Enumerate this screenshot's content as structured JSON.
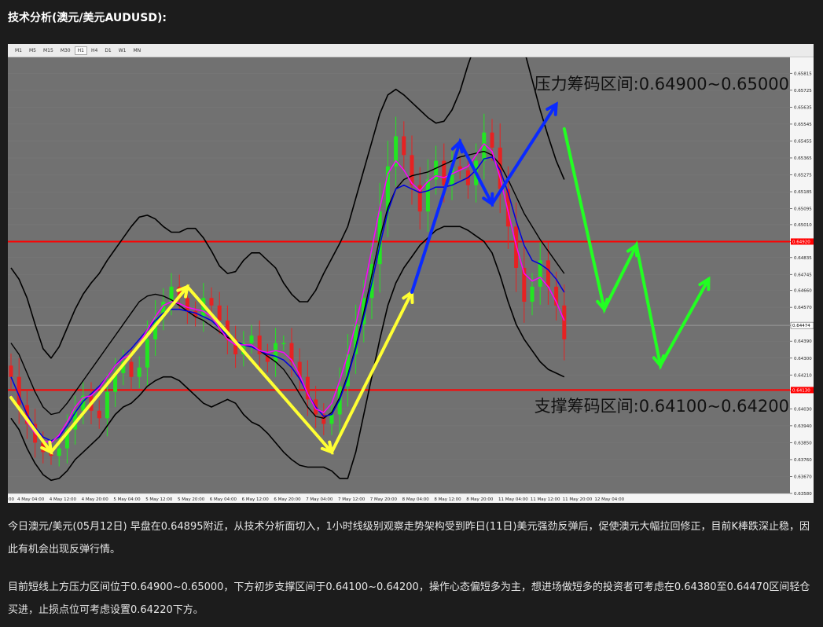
{
  "page": {
    "title": "技术分析(澳元/美元AUDUSD):",
    "paragraphs": [
      "今日澳元/美元(05月12日) 早盘在0.64895附近，从技术分析面切入，1小时线级别观察走势架构受到昨日(11日)美元强劲反弹后，促使澳元大幅拉回修正，目前K棒跌深止稳，因此有机会出现反弹行情。",
      "目前短线上方压力区间位于0.64900~0.65000，下方初步支撑区间于0.64100~0.64200，操作心态偏短多为主，想进场做短多的投资者可考虑在0.64380至0.64470区间轻仓买进，止损点位可考虑设置0.64220下方。"
    ]
  },
  "toolbar": {
    "timeframes": [
      "M1",
      "M5",
      "M15",
      "M30",
      "H1",
      "H4",
      "D1",
      "W1",
      "MN"
    ],
    "active": "H1"
  },
  "colors": {
    "page_bg": "#1c1c1c",
    "plot_bg": "#717171",
    "up_candle": "#22e622",
    "down_candle": "#e62222",
    "level_line": "#ff0000",
    "band_line": "#000000",
    "ma_fast": "#ff00ff",
    "ma_slow": "#0000dd",
    "yellow_arrow": "#ffff33",
    "blue_arrow": "#0a2aff",
    "green_arrow": "#22ff22"
  },
  "chart_data": {
    "type": "candlestick",
    "instrument": "AUDUSD",
    "timeframe": "H1",
    "ylim": [
      0.6358,
      0.659
    ],
    "y_ticks": [
      "0.65815",
      "0.65725",
      "0.65635",
      "0.65545",
      "0.65455",
      "0.65365",
      "0.65275",
      "0.65185",
      "0.65095",
      "0.65010",
      "0.64920",
      "0.64835",
      "0.64745",
      "0.64660",
      "0.64570",
      "0.64474",
      "0.64390",
      "0.64300",
      "0.64210",
      "0.64125",
      "0.64030",
      "0.63940",
      "0.63850",
      "0.63760",
      "0.63670",
      "0.63580"
    ],
    "x_ticks": [
      "00",
      "4 May 04:00",
      "4 May 12:00",
      "4 May 20:00",
      "5 May 04:00",
      "5 May 12:00",
      "5 May 20:00",
      "6 May 04:00",
      "6 May 12:00",
      "6 May 20:00",
      "7 May 04:00",
      "7 May 12:00",
      "7 May 20:00",
      "8 May 04:00",
      "8 May 12:00",
      "8 May 20:00",
      "11 May 04:00",
      "11 May 12:00",
      "11 May 20:00",
      "12 May 04:00"
    ],
    "horizontal_levels": [
      {
        "value": 0.6492,
        "label": "0.64920"
      },
      {
        "value": 0.6413,
        "label": "0.64130"
      }
    ],
    "current_price": {
      "value": 0.64474,
      "label": "0.64474"
    },
    "annotations": [
      "压力筹码区间:0.64900~0.65000",
      "支撑筹码区间:0.64100~0.64200"
    ],
    "close_series": [
      0.642,
      0.6405,
      0.6395,
      0.6385,
      0.638,
      0.6378,
      0.6382,
      0.6392,
      0.6402,
      0.641,
      0.6402,
      0.6398,
      0.6412,
      0.6422,
      0.6428,
      0.642,
      0.6425,
      0.644,
      0.6452,
      0.646,
      0.6468,
      0.6462,
      0.6455,
      0.6452,
      0.6462,
      0.6458,
      0.645,
      0.644,
      0.6432,
      0.6438,
      0.6442,
      0.6432,
      0.6428,
      0.6438,
      0.6438,
      0.6428,
      0.642,
      0.6408,
      0.64,
      0.6395,
      0.64,
      0.6415,
      0.6432,
      0.6448,
      0.6462,
      0.648,
      0.6508,
      0.6532,
      0.6548,
      0.6538,
      0.6522,
      0.6508,
      0.6525,
      0.6535,
      0.6522,
      0.6532,
      0.653,
      0.6522,
      0.6535,
      0.655,
      0.6542,
      0.652,
      0.65,
      0.6478,
      0.646,
      0.6468,
      0.6482,
      0.6468,
      0.6458,
      0.644
    ],
    "moving_average_fast": [
      0.641,
      0.6403,
      0.6396,
      0.639,
      0.6386,
      0.6385,
      0.6389,
      0.6396,
      0.6404,
      0.6409,
      0.641,
      0.6414,
      0.642,
      0.6426,
      0.643,
      0.6432,
      0.6438,
      0.6445,
      0.6452,
      0.6458,
      0.646,
      0.6459,
      0.6457,
      0.6456,
      0.6455,
      0.6452,
      0.6446,
      0.644,
      0.6437,
      0.6437,
      0.6437,
      0.6434,
      0.6433,
      0.6434,
      0.6433,
      0.6429,
      0.6421,
      0.6411,
      0.6403,
      0.6401,
      0.6406,
      0.6418,
      0.6432,
      0.6448,
      0.6466,
      0.6488,
      0.651,
      0.6528,
      0.6535,
      0.653,
      0.6523,
      0.6519,
      0.6524,
      0.6527,
      0.6526,
      0.6528,
      0.653,
      0.6532,
      0.6538,
      0.6544,
      0.654,
      0.6526,
      0.6508,
      0.649,
      0.6475,
      0.6471,
      0.6473,
      0.6468,
      0.646,
      0.645
    ],
    "moving_average_slow": [
      0.642,
      0.641,
      0.64,
      0.6393,
      0.6388,
      0.6386,
      0.6388,
      0.6394,
      0.6401,
      0.6407,
      0.6411,
      0.6415,
      0.642,
      0.6426,
      0.6431,
      0.6435,
      0.644,
      0.6445,
      0.645,
      0.6454,
      0.6456,
      0.6456,
      0.6455,
      0.6454,
      0.6452,
      0.645,
      0.6446,
      0.6442,
      0.6439,
      0.6437,
      0.6436,
      0.6434,
      0.6432,
      0.6431,
      0.6429,
      0.6425,
      0.6419,
      0.6411,
      0.6404,
      0.6399,
      0.64,
      0.6408,
      0.642,
      0.6435,
      0.6452,
      0.647,
      0.649,
      0.6508,
      0.652,
      0.6522,
      0.652,
      0.6518,
      0.6519,
      0.6521,
      0.6521,
      0.6522,
      0.6524,
      0.6526,
      0.653,
      0.6536,
      0.6537,
      0.653,
      0.6518,
      0.6503,
      0.649,
      0.6482,
      0.648,
      0.6477,
      0.6472,
      0.6465
    ],
    "band_upper": [
      0.6478,
      0.6472,
      0.6462,
      0.6448,
      0.6435,
      0.643,
      0.6436,
      0.6446,
      0.6456,
      0.6464,
      0.647,
      0.6475,
      0.6482,
      0.6488,
      0.6494,
      0.65,
      0.6505,
      0.6506,
      0.6504,
      0.65,
      0.6497,
      0.6497,
      0.6499,
      0.6499,
      0.6494,
      0.6487,
      0.6479,
      0.6475,
      0.6476,
      0.6482,
      0.6486,
      0.6486,
      0.6482,
      0.6478,
      0.647,
      0.6464,
      0.646,
      0.646,
      0.6466,
      0.6475,
      0.6483,
      0.6491,
      0.65,
      0.6515,
      0.653,
      0.6545,
      0.656,
      0.657,
      0.6573,
      0.657,
      0.6566,
      0.6562,
      0.6558,
      0.6555,
      0.6556,
      0.6562,
      0.6572,
      0.6586,
      0.6598,
      0.6608,
      0.6614,
      0.6616,
      0.6614,
      0.6608,
      0.6594,
      0.6578,
      0.6562,
      0.6548,
      0.6535,
      0.6525
    ],
    "band_middle": [
      0.6438,
      0.6432,
      0.6422,
      0.6412,
      0.6404,
      0.64,
      0.6401,
      0.6406,
      0.6412,
      0.6418,
      0.6424,
      0.643,
      0.6436,
      0.6442,
      0.6448,
      0.6454,
      0.646,
      0.6463,
      0.6464,
      0.6463,
      0.6461,
      0.6458,
      0.6455,
      0.6452,
      0.645,
      0.6447,
      0.6444,
      0.6441,
      0.6439,
      0.6437,
      0.6436,
      0.6434,
      0.6431,
      0.6428,
      0.6424,
      0.6418,
      0.6411,
      0.6404,
      0.6399,
      0.6398,
      0.6401,
      0.6409,
      0.6421,
      0.6436,
      0.6454,
      0.6474,
      0.6494,
      0.651,
      0.652,
      0.6525,
      0.6527,
      0.6528,
      0.6529,
      0.6531,
      0.6533,
      0.6535,
      0.6537,
      0.6538,
      0.6539,
      0.654,
      0.6538,
      0.6533,
      0.6525,
      0.6516,
      0.6507,
      0.65,
      0.6493,
      0.6487,
      0.6481,
      0.6475
    ],
    "band_lower": [
      0.6398,
      0.6392,
      0.6382,
      0.6374,
      0.6368,
      0.6365,
      0.6366,
      0.637,
      0.6376,
      0.638,
      0.6384,
      0.6388,
      0.6394,
      0.64,
      0.6404,
      0.6406,
      0.641,
      0.6415,
      0.6418,
      0.642,
      0.642,
      0.6418,
      0.6414,
      0.641,
      0.6406,
      0.6404,
      0.6406,
      0.6408,
      0.6406,
      0.64,
      0.6396,
      0.6394,
      0.639,
      0.6385,
      0.638,
      0.6376,
      0.6373,
      0.6372,
      0.6372,
      0.6372,
      0.637,
      0.6366,
      0.6366,
      0.638,
      0.64,
      0.642,
      0.644,
      0.6458,
      0.647,
      0.6478,
      0.6484,
      0.649,
      0.6494,
      0.6498,
      0.65,
      0.65,
      0.65,
      0.6498,
      0.6495,
      0.6492,
      0.6486,
      0.6474,
      0.646,
      0.6448,
      0.644,
      0.6434,
      0.6428,
      0.6424,
      0.6422,
      0.642
    ],
    "arrows": [
      {
        "color": "yellow",
        "path": [
          [
            0,
            0.6409
          ],
          [
            5,
            0.638
          ],
          [
            22,
            0.6468
          ],
          [
            40,
            0.638
          ],
          [
            50,
            0.6465
          ]
        ]
      },
      {
        "color": "blue",
        "path": [
          [
            50,
            0.6465
          ],
          [
            56,
            0.6545
          ],
          [
            60,
            0.6512
          ],
          [
            68,
            0.6565
          ]
        ]
      },
      {
        "color": "green",
        "path": [
          [
            69,
            0.6552
          ],
          [
            74,
            0.6456
          ],
          [
            78,
            0.649
          ],
          [
            81,
            0.6426
          ],
          [
            87,
            0.6472
          ]
        ]
      }
    ]
  }
}
